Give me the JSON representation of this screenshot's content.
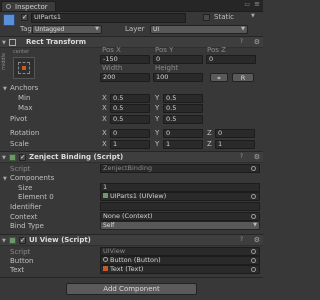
{
  "window": {
    "tab": "Inspector"
  },
  "object": {
    "name": "UIParts1",
    "static_label": "Static",
    "tag_label": "Tag",
    "tag_value": "Untagged",
    "layer_label": "Layer",
    "layer_value": "UI"
  },
  "rect_transform": {
    "title": "Rect Transform",
    "anchor_h": "center",
    "anchor_v": "middle",
    "headers": [
      "Pos X",
      "Pos Y",
      "Pos Z"
    ],
    "pos": [
      "-150",
      "0",
      "0"
    ],
    "size_headers": [
      "Width",
      "Height"
    ],
    "size": [
      "200",
      "100"
    ],
    "r_button": "R",
    "anchors": "Anchors",
    "min_label": "Min",
    "min": [
      "0.5",
      "0.5"
    ],
    "max_label": "Max",
    "max": [
      "0.5",
      "0.5"
    ],
    "pivot_label": "Pivot",
    "pivot": [
      "0.5",
      "0.5"
    ],
    "rotation_label": "Rotation",
    "rotation": [
      "0",
      "0",
      "0"
    ],
    "scale_label": "Scale",
    "scale": [
      "1",
      "1",
      "1"
    ],
    "axes": [
      "X",
      "Y",
      "Z"
    ]
  },
  "zenject": {
    "title": "Zenject Binding (Script)",
    "script_label": "Script",
    "script_value": "ZenjectBinding",
    "components_label": "Components",
    "size_label": "Size",
    "size_value": "1",
    "element_label": "Element 0",
    "element_value": "UIParts1 (UIView)",
    "identifier_label": "Identifier",
    "context_label": "Context",
    "context_value": "None (Context)",
    "bind_type_label": "Bind Type",
    "bind_type_value": "Self"
  },
  "uiview": {
    "title": "UI View (Script)",
    "script_label": "Script",
    "script_value": "UIView",
    "button_label": "Button",
    "button_value": "Button (Button)",
    "text_label": "Text",
    "text_value": "Text (Text)"
  },
  "add_component": "Add Component",
  "colors": {
    "bg": "#383838",
    "header": "#3e3e3e",
    "field": "#2a2a2a",
    "tabbar": "#262626",
    "gameobject_icon": "#5b8fd8",
    "script_icon": "#6a9a6a"
  }
}
